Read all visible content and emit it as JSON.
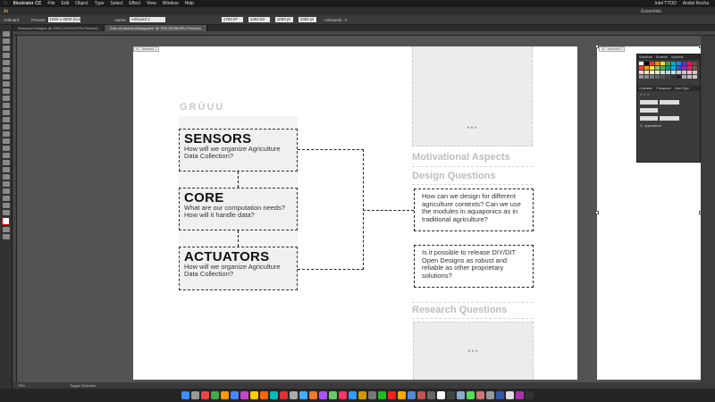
{
  "menubar": {
    "app": "Illustrator CC",
    "items": [
      "File",
      "Edit",
      "Object",
      "Type",
      "Select",
      "Effect",
      "View",
      "Window",
      "Help"
    ],
    "status": "Intel TTOD",
    "user": "André Rocha",
    "workspace": "Essentials"
  },
  "ctrl": {
    "mode": "Artboard",
    "preset": "Presets",
    "preset_value": "1000 x 3000 (Custom)",
    "name_label": "Name:",
    "name_value": "Artboard 2",
    "x_value": "1793.97 pt",
    "y_value": "1494.83 pt",
    "w_value": "1000 pt",
    "h_value": "1000 pt",
    "artboards_label": "Artboards:",
    "artboards_value": "2"
  },
  "tabs": [
    {
      "label": "Research Designs @ 100% (CMYK/GPU Preview)"
    },
    {
      "label": "Grid-of-Interest.ai/diagrams* @ 75% (RGB/GPU Preview)"
    }
  ],
  "status": {
    "zoom": "75%",
    "tool": "Toggle Selection"
  },
  "canvas": {
    "artboard1_label": "01 - Artboard 1",
    "artboard2_label": "02 - Artboard 2",
    "logo": "GRÜUU",
    "modules": [
      {
        "title": "SENSORS",
        "desc": "How will we organize Agriculture Data Collection?"
      },
      {
        "title": "CORE",
        "desc": "What are our computation needs? How will it handle data?"
      },
      {
        "title": "ACTUATORS",
        "desc": "How will we organize Agriculture Data Collection?"
      }
    ],
    "ellipsis": "•••",
    "headings": {
      "motivational": "Motivational Aspects",
      "design": "Design Questions",
      "research": "Research Questions"
    },
    "questions": [
      "How can we design for different agriculture contexts? Can we use the modules in aquaponics as in traditional agriculture?",
      "Is it possible to release DIY/DIT Open Designs as robust and reliable as other proprietary solutions?"
    ]
  },
  "panel": {
    "tabs": [
      "Swatches",
      "Brushes",
      "Symbols"
    ],
    "tabs2": [
      "Character",
      "Paragraph",
      "OpenType"
    ],
    "extra": "Appearance",
    "values": [
      "0 pt",
      "0 pt",
      "0 pt",
      "0 pt",
      "0 pt"
    ]
  },
  "colors": {
    "accent": "#2b2b2b",
    "artboard": "#ffffff",
    "canvas": "#535353"
  }
}
